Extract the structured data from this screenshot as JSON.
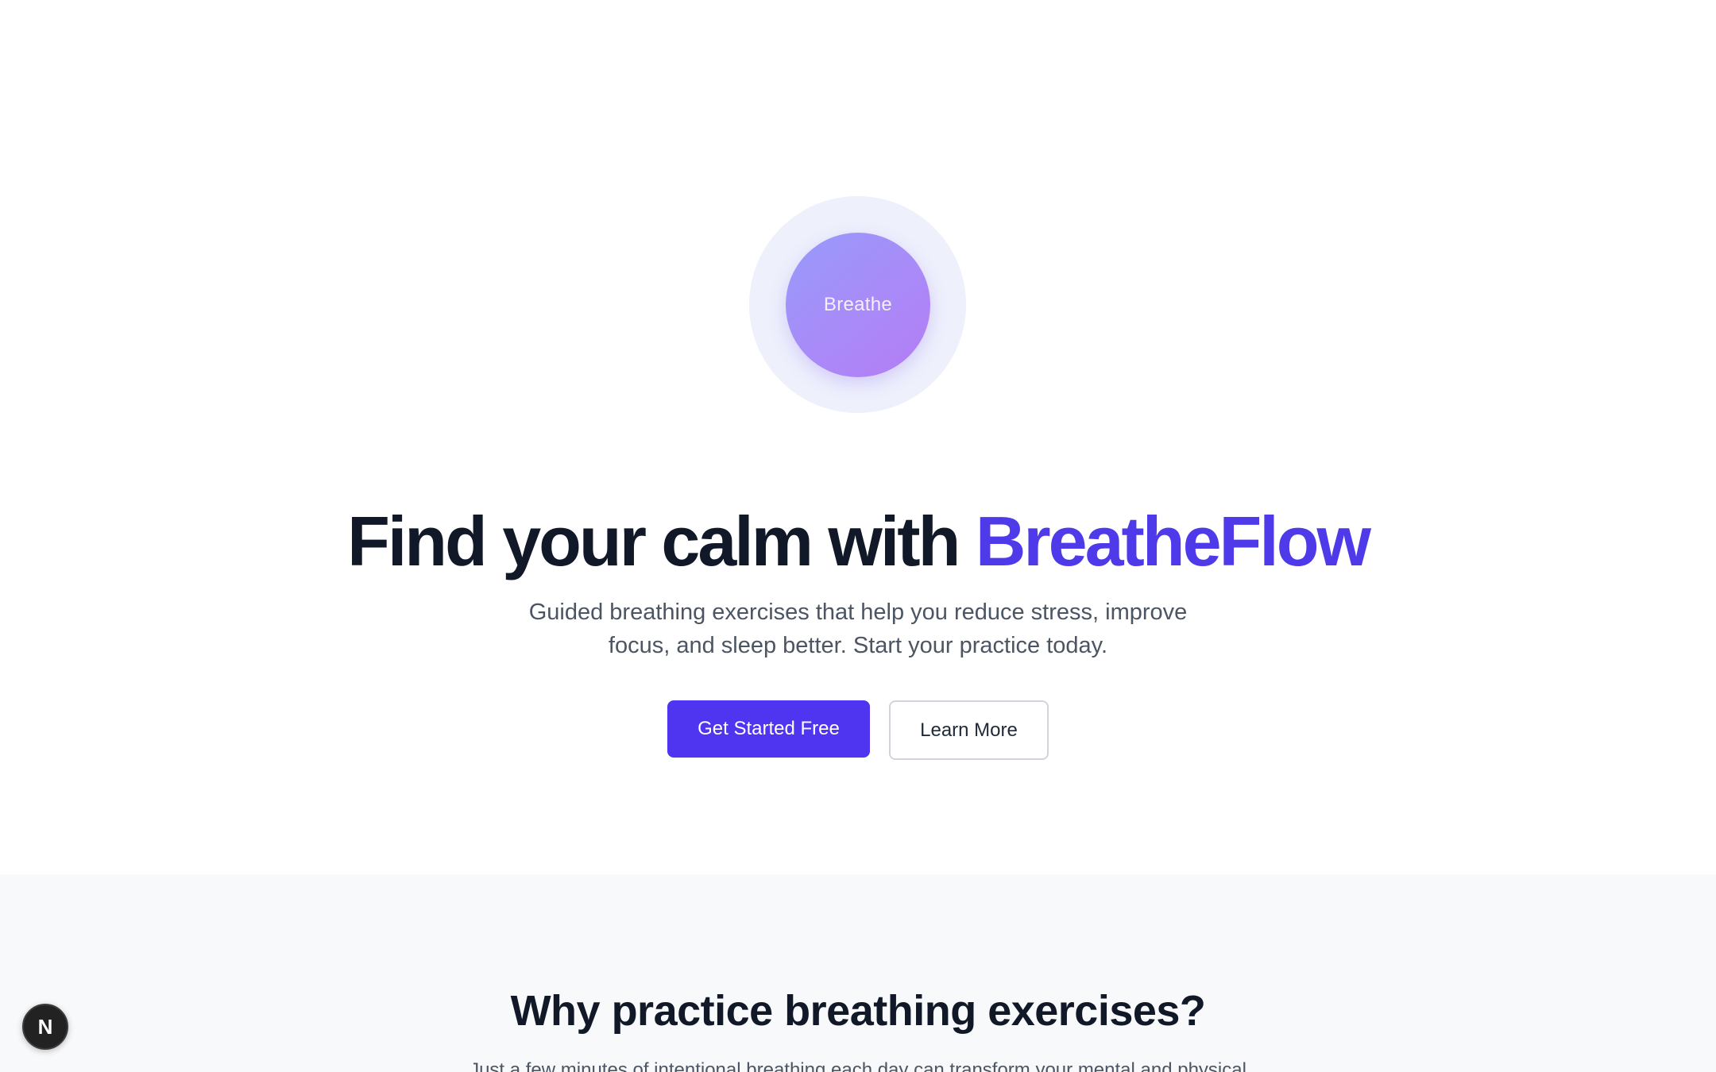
{
  "hero": {
    "breathe_circle_label": "Breathe",
    "headline_main": "Find your calm with ",
    "headline_brand": "BreatheFlow",
    "subtitle": "Guided breathing exercises that help you reduce stress, improve focus, and sleep better. Start your practice today.",
    "primary_button": "Get Started Free",
    "secondary_button": "Learn More"
  },
  "features": {
    "title": "Why practice breathing exercises?",
    "intro": "Just a few minutes of intentional breathing each day can transform your mental and physical"
  },
  "dev_badge": {
    "letter": "N",
    "icon": "nextjs-logo-icon"
  },
  "colors": {
    "brand": "#4f3aea",
    "primary_button": "#4f35f0",
    "heading": "#111827",
    "body_text": "#4b5563",
    "section_bg": "#f8f9fb"
  }
}
